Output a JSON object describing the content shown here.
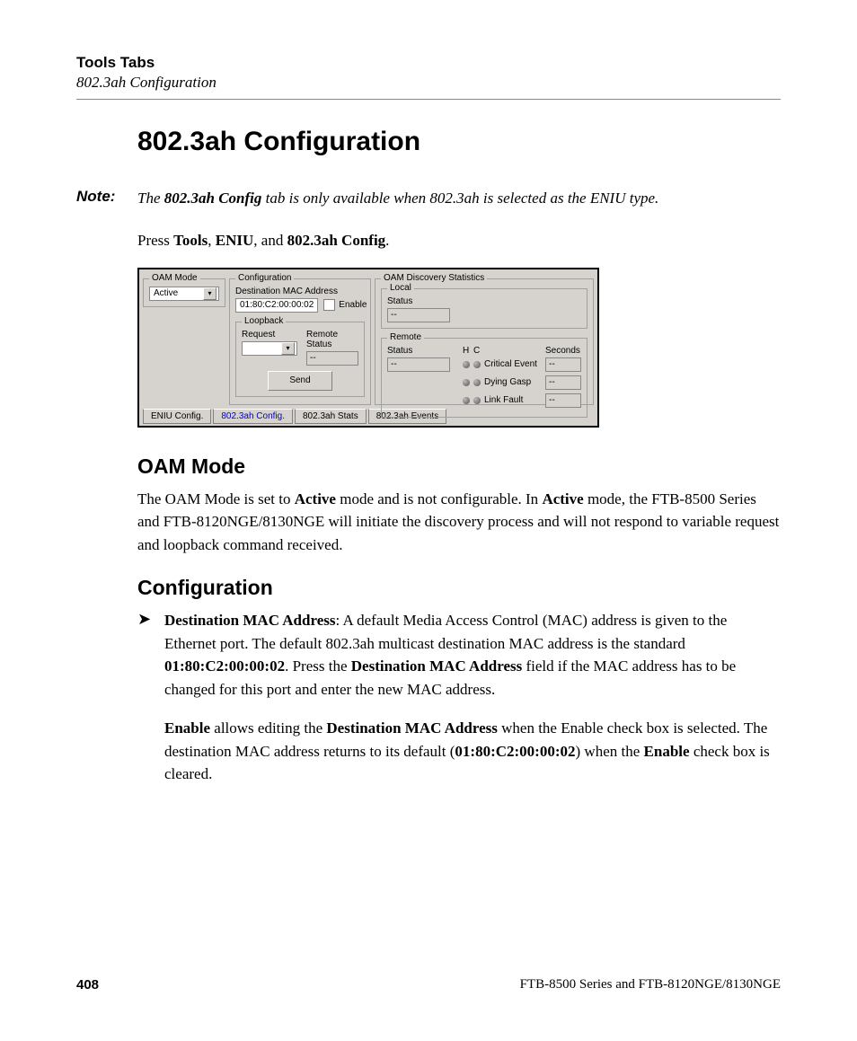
{
  "header": {
    "chapter": "Tools Tabs",
    "section": "802.3ah Configuration"
  },
  "title": "802.3ah Configuration",
  "note": {
    "label": "Note:",
    "pre": "The ",
    "bold": "802.3ah Config",
    "post": " tab is only available when 802.3ah is selected as the ENIU type."
  },
  "press": {
    "pre": "Press ",
    "b1": "Tools",
    "sep1": ", ",
    "b2": "ENIU",
    "sep2": ", and ",
    "b3": "802.3ah Config",
    "post": "."
  },
  "fig": {
    "oam_mode_grp": "OAM Mode",
    "oam_mode_value": "Active",
    "config_grp": "Configuration",
    "dest_mac_label": "Destination MAC Address",
    "dest_mac_value": "01:80:C2:00:00:02",
    "enable_label": "Enable",
    "loopback_grp": "Loopback",
    "request_label": "Request",
    "remote_status_label": "Remote Status",
    "remote_status_value": "--",
    "send_btn": "Send",
    "disc_grp": "OAM Discovery Statistics",
    "local_grp": "Local",
    "status_label": "Status",
    "status_value": "--",
    "remote_grp": "Remote",
    "h_col": "H",
    "c_col": "C",
    "seconds_col": "Seconds",
    "rows": {
      "0": {
        "label": "Critical Event",
        "val": "--"
      },
      "1": {
        "label": "Dying Gasp",
        "val": "--"
      },
      "2": {
        "label": "Link Fault",
        "val": "--"
      }
    },
    "tabs": {
      "0": "ENIU Config.",
      "1": "802.3ah Config.",
      "2": "802.3ah Stats",
      "3": "802.3ah Events"
    }
  },
  "s1": {
    "h": "OAM Mode",
    "p_a": "The OAM Mode is set to ",
    "p_b1": "Active",
    "p_c": " mode and is not configurable. In ",
    "p_b2": "Active",
    "p_d": " mode, the FTB-8500 Series and FTB-8120NGE/8130NGE will initiate the discovery process and will not respond to variable request and loopback command received."
  },
  "s2": {
    "h": "Configuration",
    "item1": {
      "b1": "Destination MAC Address",
      "t1": ": A default Media Access Control (MAC) address is given to the Ethernet port. The default 802.3ah multicast destination MAC address is the standard ",
      "b2": "01:80:C2:00:00:02",
      "t2": ". Press the ",
      "b3": "Destination MAC Address",
      "t3": " field if the MAC address has to be changed for this port and enter the new MAC address."
    },
    "item2": {
      "b1": "Enable",
      "t1": " allows editing the ",
      "b2": "Destination MAC Address",
      "t2": " when the Enable check box is selected. The destination MAC address returns to its default (",
      "b3": "01:80:C2:00:00:02",
      "t3": ") when the ",
      "b4": "Enable",
      "t4": " check box is cleared."
    }
  },
  "footer": {
    "page": "408",
    "product": "FTB-8500 Series and FTB-8120NGE/8130NGE"
  }
}
